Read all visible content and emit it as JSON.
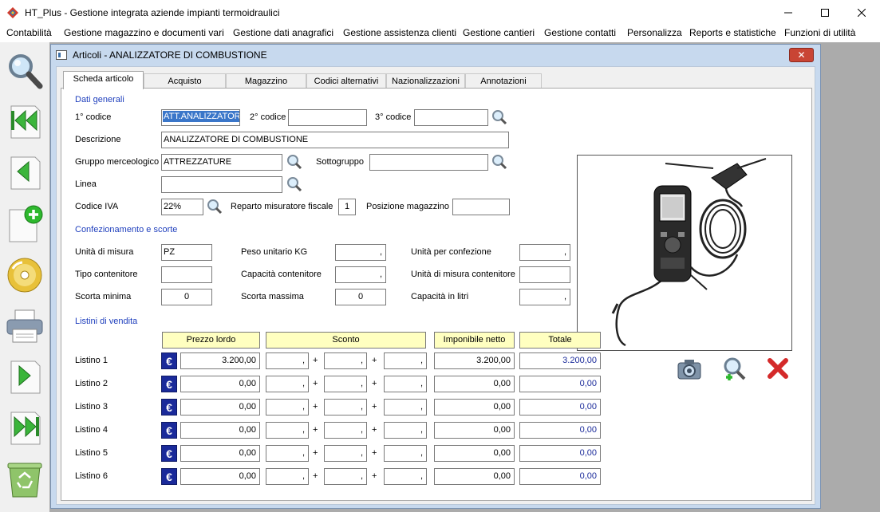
{
  "window": {
    "title": "HT_Plus - Gestione integrata aziende impianti termoidraulici"
  },
  "menu": [
    "Contabilità",
    "Gestione magazzino e documenti vari",
    "Gestione dati anagrafici",
    "Gestione assistenza clienti",
    "Gestione cantieri",
    "Gestione contatti",
    "Personalizza",
    "Reports e statistiche",
    "Funzioni di utilità"
  ],
  "child": {
    "title": "Articoli - ANALIZZATORE DI COMBUSTIONE"
  },
  "tabs": [
    "Scheda articolo",
    "Acquisto",
    "Magazzino",
    "Codici alternativi",
    "Nazionalizzazioni",
    "Annotazioni"
  ],
  "general": {
    "section": "Dati generali",
    "code1_label": "1° codice",
    "code1": "ATT.ANALIZZATORE",
    "code2_label": "2° codice",
    "code2": "",
    "code3_label": "3° codice",
    "code3": "",
    "description_label": "Descrizione",
    "description": "ANALIZZATORE DI COMBUSTIONE",
    "group_label": "Gruppo merceologico",
    "group": "ATTREZZATURE",
    "subgroup_label": "Sottogruppo",
    "subgroup": "",
    "line_label": "Linea",
    "line": "",
    "vat_label": "Codice IVA",
    "vat": "22%",
    "department_label": "Reparto misuratore fiscale",
    "department": "1",
    "position_label": "Posizione magazzino",
    "position": ""
  },
  "packaging": {
    "section": "Confezionamento e scorte",
    "unit_label": "Unità di misura",
    "unit": "PZ",
    "weight_label": "Peso unitario KG",
    "weight": ",",
    "per_pack_label": "Unità per confezione",
    "per_pack": ",",
    "container_type_label": "Tipo contenitore",
    "container_type": "",
    "container_capacity_label": "Capacità contenitore",
    "container_capacity": ",",
    "container_unit_label": "Unità di misura contenitore",
    "container_unit": "",
    "min_stock_label": "Scorta minima",
    "min_stock": "0",
    "max_stock_label": "Scorta massima",
    "max_stock": "0",
    "liters_label": "Capacità in litri",
    "liters": ","
  },
  "prices": {
    "section": "Listini di vendita",
    "headers": {
      "gross": "Prezzo lordo",
      "discount": "Sconto",
      "net": "Imponibile netto",
      "total": "Totale"
    },
    "currency_symbol": "€",
    "plus": "+",
    "rows": [
      {
        "label": "Listino 1",
        "gross": "3.200,00",
        "d1": ",",
        "d2": ",",
        "d3": ",",
        "net": "3.200,00",
        "total": "3.200,00"
      },
      {
        "label": "Listino 2",
        "gross": "0,00",
        "d1": ",",
        "d2": ",",
        "d3": ",",
        "net": "0,00",
        "total": "0,00"
      },
      {
        "label": "Listino 3",
        "gross": "0,00",
        "d1": ",",
        "d2": ",",
        "d3": ",",
        "net": "0,00",
        "total": "0,00"
      },
      {
        "label": "Listino 4",
        "gross": "0,00",
        "d1": ",",
        "d2": ",",
        "d3": ",",
        "net": "0,00",
        "total": "0,00"
      },
      {
        "label": "Listino 5",
        "gross": "0,00",
        "d1": ",",
        "d2": ",",
        "d3": ",",
        "net": "0,00",
        "total": "0,00"
      },
      {
        "label": "Listino 6",
        "gross": "0,00",
        "d1": ",",
        "d2": ",",
        "d3": ",",
        "net": "0,00",
        "total": "0,00"
      }
    ]
  },
  "icons": {
    "toolbar": [
      "search-icon",
      "first-record-icon",
      "previous-record-icon",
      "new-record-icon",
      "save-disc-icon",
      "print-icon",
      "next-record-icon",
      "last-record-icon",
      "recycle-bin-icon"
    ],
    "image_actions": [
      "camera-icon",
      "zoom-image-icon",
      "delete-image-icon"
    ]
  },
  "colors": {
    "section_title": "#1f3fbd",
    "header_fill": "#ffffc0",
    "euro_button": "#1a2a9a",
    "selection": "#3a76c9",
    "child_frame": "#c7d9ee",
    "mdi_background": "#ababab"
  }
}
